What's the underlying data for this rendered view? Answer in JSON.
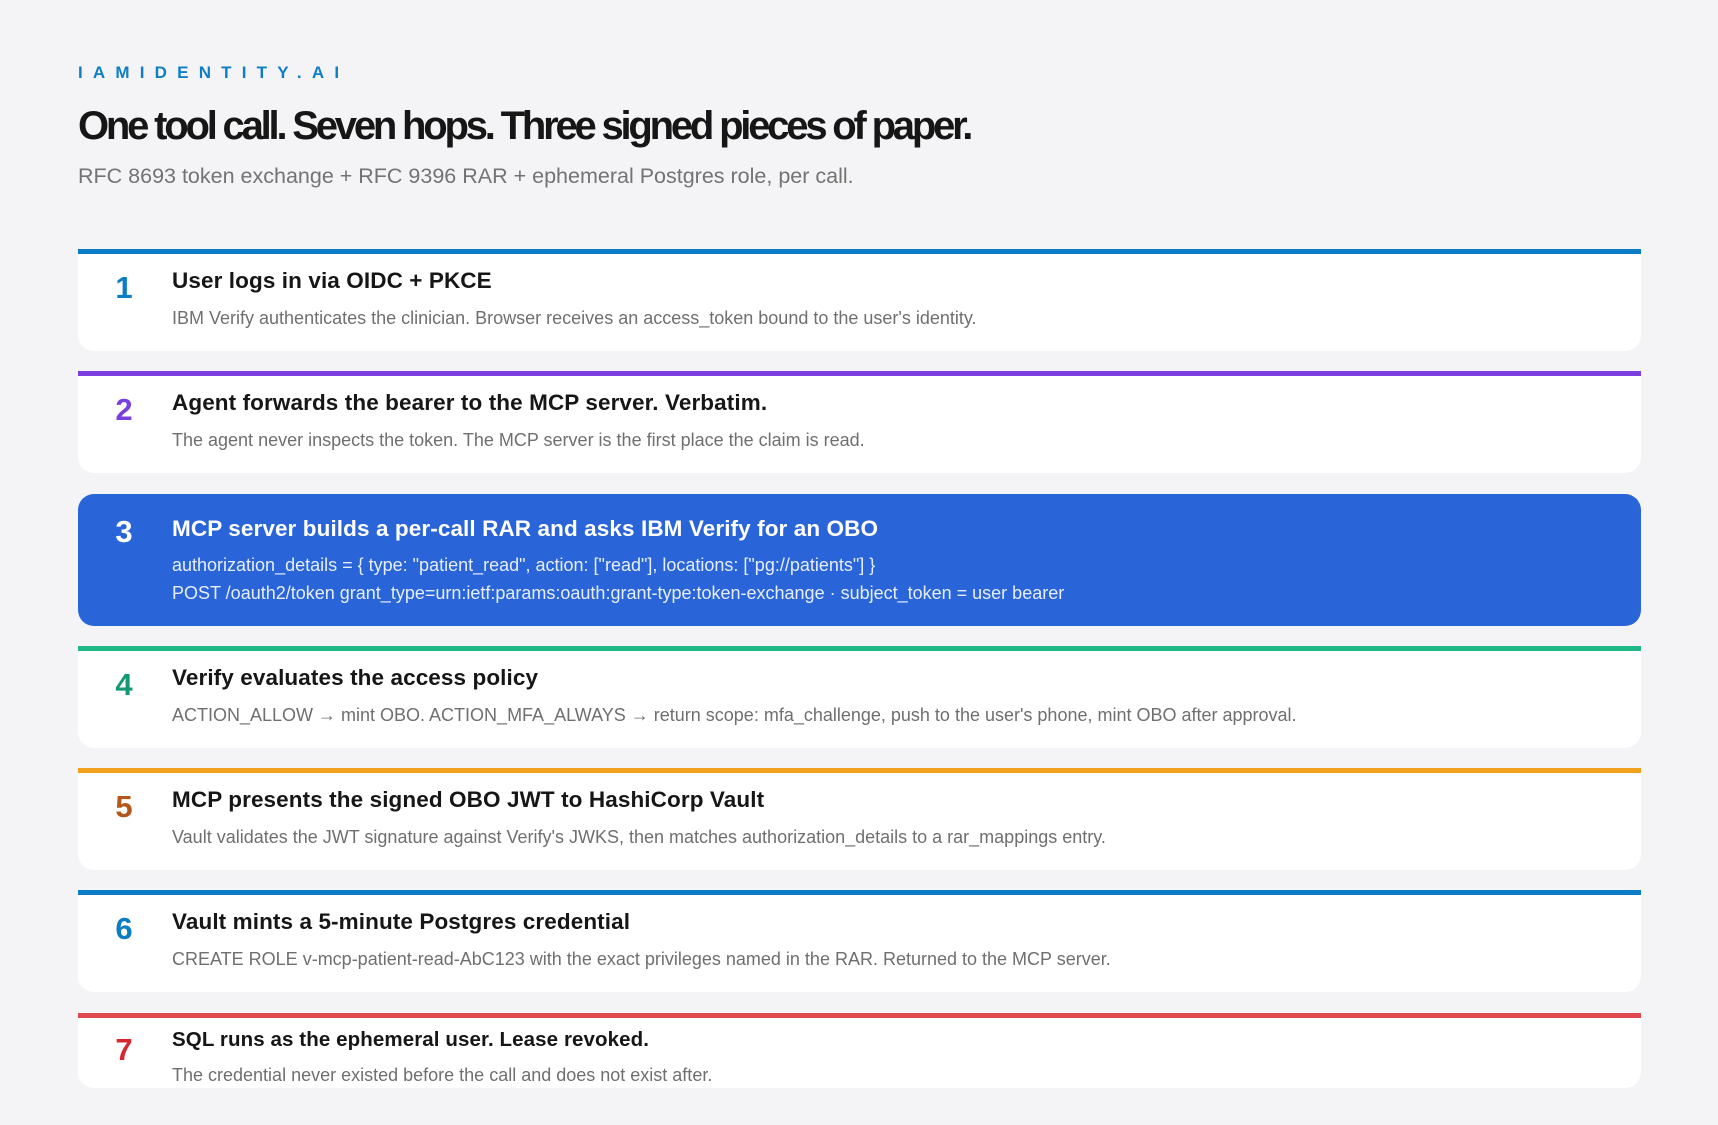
{
  "brand": "IAMIDENTITY.AI",
  "headline": "One tool call. Seven hops. Three signed pieces of paper.",
  "subtitle": "RFC 8693 token exchange + RFC 9396 RAR + ephemeral Postgres role, per call.",
  "colors": {
    "brand": "#0f7fc4",
    "step1": "#0b7dc5",
    "step2": "#7b3fe0",
    "step3_bg": "#2965d8",
    "step4": "#1fb886",
    "step5": "#f2a11c",
    "step6": "#0b7dc5",
    "step7": "#e04a4f"
  },
  "steps": [
    {
      "number": "1",
      "title": "User logs in via OIDC + PKCE",
      "lines": [
        "IBM Verify authenticates the clinician. Browser receives an access_token bound to the user's identity."
      ]
    },
    {
      "number": "2",
      "title": "Agent forwards the bearer to the MCP server. Verbatim.",
      "lines": [
        "The agent never inspects the token. The MCP server is the first place the claim is read."
      ]
    },
    {
      "number": "3",
      "title": "MCP server builds a per-call RAR and asks IBM Verify for an OBO",
      "lines": [
        "authorization_details = { type: \"patient_read\", action: [\"read\"], locations: [\"pg://patients\"] }",
        "POST /oauth2/token grant_type=urn:ietf:params:oauth:grant-type:token-exchange · subject_token = user bearer"
      ]
    },
    {
      "number": "4",
      "title": "Verify evaluates the access policy",
      "lines": [
        "ACTION_ALLOW → mint OBO. ACTION_MFA_ALWAYS → return scope: mfa_challenge, push to the user's phone, mint OBO after approval."
      ]
    },
    {
      "number": "5",
      "title": "MCP presents the signed OBO JWT to HashiCorp Vault",
      "lines": [
        "Vault validates the JWT signature against Verify's JWKS, then matches authorization_details to a rar_mappings entry."
      ]
    },
    {
      "number": "6",
      "title": "Vault mints a 5-minute Postgres credential",
      "lines": [
        "CREATE ROLE v-mcp-patient-read-AbC123 with the exact privileges named in the RAR. Returned to the MCP server."
      ]
    },
    {
      "number": "7",
      "title": "SQL runs as the ephemeral user. Lease revoked.",
      "lines": [
        "The credential never existed before the call and does not exist after."
      ]
    }
  ]
}
